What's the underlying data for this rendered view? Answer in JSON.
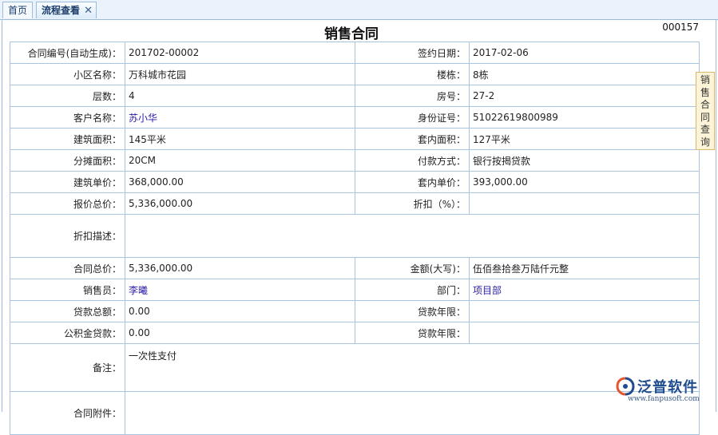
{
  "tabs": {
    "home": "首页",
    "active": "流程查看"
  },
  "form": {
    "title": "销售合同",
    "doc_number": "000157",
    "rows": [
      {
        "l1": "合同编号(自动生成)：",
        "v1": "201702-00002",
        "l2": "签约日期：",
        "v2": "2017-02-06"
      },
      {
        "l1": "小区名称：",
        "v1": "万科城市花园",
        "l2": "楼栋：",
        "v2": "8栋"
      },
      {
        "l1": "层数：",
        "v1": "4",
        "l2": "房号：",
        "v2": "27-2"
      },
      {
        "l1": "客户名称：",
        "v1": "苏小华",
        "l2": "身份证号：",
        "v2": "51022619800989"
      },
      {
        "l1": "建筑面积：",
        "v1": "145平米",
        "l2": "套内面积：",
        "v2": "127平米"
      },
      {
        "l1": "分摊面积：",
        "v1": "20CM",
        "l2": "付款方式：",
        "v2": "银行按揭贷款"
      },
      {
        "l1": "建筑单价：",
        "v1": "368,000.00",
        "l2": "套内单价：",
        "v2": "393,000.00"
      },
      {
        "l1": "报价总价：",
        "v1": "5,336,000.00",
        "l2": "折扣（%）：",
        "v2": ""
      },
      {
        "l1": "折扣描述：",
        "v1": ""
      },
      {
        "l1": "合同总价：",
        "v1": "5,336,000.00",
        "l2": "金额(大写)：",
        "v2": "伍佰叁拾叁万陆仟元整"
      },
      {
        "l1": "销售员：",
        "v1": "李曦",
        "l2": "部门：",
        "v2": "项目部"
      },
      {
        "l1": "贷款总额：",
        "v1": "0.00",
        "l2": "贷款年限：",
        "v2": ""
      },
      {
        "l1": "公积金贷款：",
        "v1": "0.00",
        "l2": "贷款年限：",
        "v2": ""
      },
      {
        "l1": "备注：",
        "v1": "一次性支付"
      },
      {
        "l1": "合同附件：",
        "v1": ""
      }
    ]
  },
  "side_tab": {
    "label": [
      "销",
      "售",
      "合",
      "同",
      "查",
      "询"
    ]
  },
  "logo": {
    "name": "泛普软件",
    "url": "www.fanpusoft.com"
  }
}
